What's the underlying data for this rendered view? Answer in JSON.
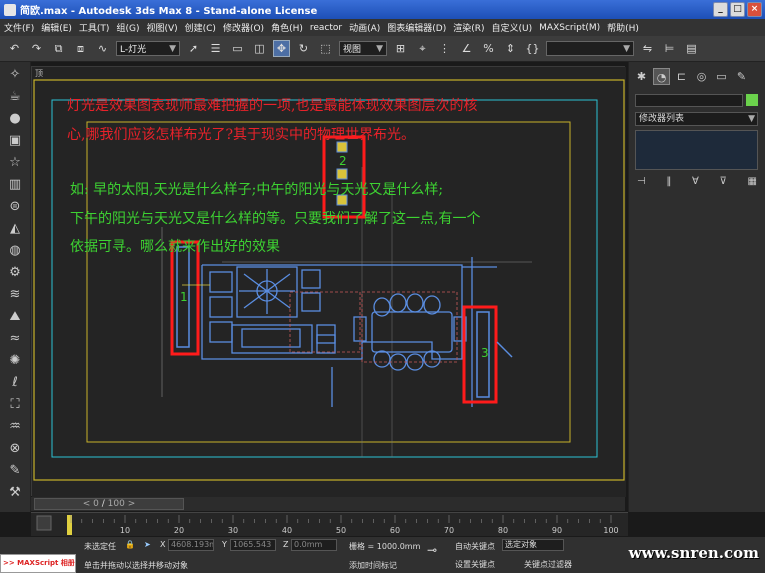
{
  "window": {
    "title": "简欧.max - Autodesk 3ds Max 8 - Stand-alone License"
  },
  "menu": [
    "文件(F)",
    "编辑(E)",
    "工具(T)",
    "组(G)",
    "视图(V)",
    "创建(C)",
    "修改器(O)",
    "角色(H)",
    "reactor",
    "动画(A)",
    "图表编辑器(D)",
    "渲染(R)",
    "自定义(U)",
    "MAXScript(M)",
    "帮助(H)"
  ],
  "toolbar": {
    "selection_set": "L-灯光",
    "coord_system": "视图"
  },
  "viewport": {
    "label": "顶",
    "annotation_red": [
      "灯光是效果图表现师最难把握的一项,也是最能体现效果图层次的核",
      "心,哪我们应该怎样布光了?其于现实中的物理世界布光。"
    ],
    "annotation_green": [
      "如: 早的太阳,天光是什么样子;中午的阳光与天光又是什么样;",
      "下午的阳光与天光又是什么样的等。只要我们了解了这一点,有一个",
      "依据可寻。哪么就来作出好的效果"
    ],
    "marker_labels": [
      "1",
      "2",
      "3"
    ]
  },
  "right_panel": {
    "modifier_list": "修改器列表"
  },
  "timeline": {
    "frame_current": "0",
    "frame_total": "100",
    "ruler_ticks": [
      "10",
      "20",
      "30",
      "40",
      "50",
      "60",
      "70",
      "80",
      "90",
      "100"
    ]
  },
  "status": {
    "selection": "未选定任",
    "prompt": "单击并拖动以选择并移动对象",
    "x_value": "4608.193m",
    "y_value": "1065.543",
    "z_value": "0.0mm",
    "grid_label": "栅格 = 1000.0mm",
    "add_time_tag": "添加时间标记",
    "auto_key": "自动关键点",
    "selected_filter": "选定对象",
    "set_key": "设置关键点",
    "key_filters": "关键点过滤器"
  },
  "maxscript_label": ">> MAXScript 相册",
  "watermark": "www.snren.com",
  "colors": {
    "annotation_red": "#e8222a",
    "annotation_green": "#3dd232",
    "highlight_box": "#ff1b1b",
    "plan_lines": "#5a8de0"
  }
}
